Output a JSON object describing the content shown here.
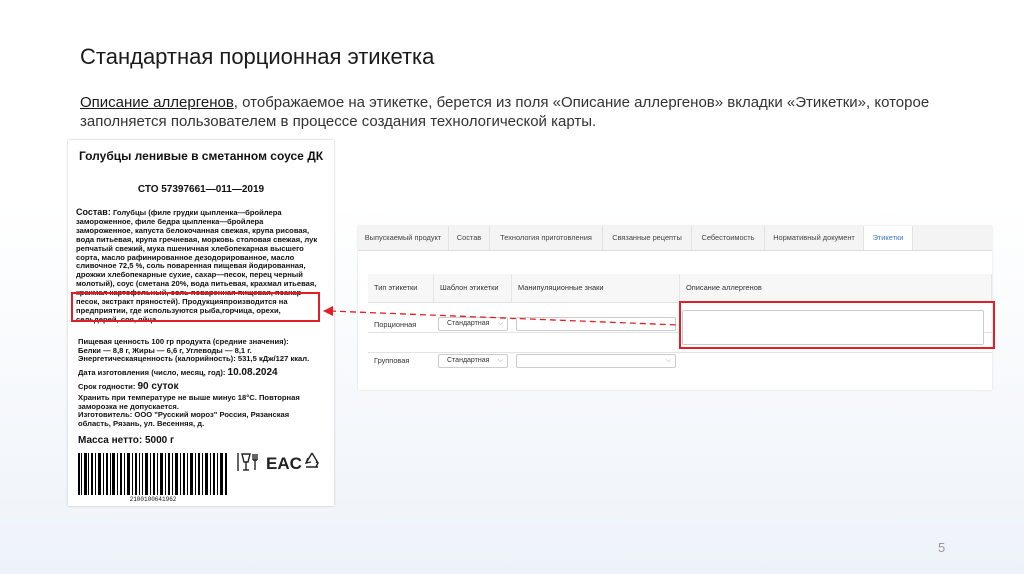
{
  "slide": {
    "title": "Стандартная порционная этикетка",
    "intro_highlight": "Описание аллергенов",
    "intro_rest": ", отображаемое на этикетке, берется из поля «Описание аллергенов» вкладки «Этикетки», которое заполняется пользователем в процессе создания технологической карты.",
    "page_number": "5"
  },
  "label": {
    "product_name": "Голубцы ленивые в сметанном соусе ДК",
    "standard": "СТО 57397661—011—2019",
    "composition_title": "Состав:",
    "composition_text": "Голубцы (филе грудки цыпленка—бройлера замороженное, филе бедра цыпленка—бройлера замороженное, капуста белокочанная свежая, крупа рисовая, вода питьевая, крупа гречневая, морковь столовая свежая, лук репчатый свежий, мука пшеничная хлебопекарная высшего сорта, масло рафинированное дезодорированное, масло сливочное 72,5 %, соль поваренная пищевая йодированная, дрожжи хлебопекарные сухие, сахар—песок, перец черный молотый), соус (сметана 20%, вода питьевая, крахмал итьевая, крахмал картофельный, соль поваренная пищевая, псахар—песок, экстракт пряностей). Продукцияпроизводится на предприятии, где используются рыба,горчица, орехи, сельдерей, соя, яйца.",
    "nutrition_lines": [
      "Пищевая ценность 100 гр продукта (средние значения):",
      "Белки — 8,8 г, Жиры — 6,6 г, Углеводы — 8,1 г.",
      "Энергетическаяценность (калорийность): 531,5 кДж/127 ккал."
    ],
    "made_label": "Дата изготовления (число, месяц, год):",
    "made_value": "10.08.2024",
    "shelf_label": "Срок годности:",
    "shelf_value": "90 суток",
    "storage_text": "Хранить при температуре не выше минус 18°С. Повторная заморозка не допускается.",
    "maker_text": "Изготовитель: ООО \"Русский мороз\" Россия, Рязанская область, Рязань, ул. Весенняя, д.",
    "net_weight": "Масса нетто: 5000 г",
    "barcode_number": "2100100641962",
    "icons": [
      "glass-fork-icon",
      "eac-mark-icon",
      "recycle-icon"
    ]
  },
  "app": {
    "tabs": [
      "Выпускаемый продукт",
      "Состав",
      "Технология приготовления",
      "Связанные рецепты",
      "Себестоимость",
      "Нормативный документ",
      "Этикетки"
    ],
    "active_tab": "Этикетки",
    "columns": [
      "Тип этикетки",
      "Шаблон этикетки",
      "Манипуляционные знаки",
      "Описание аллергенов"
    ],
    "rows": [
      {
        "type": "Порционная",
        "template": "Стандартная",
        "signs": "",
        "allergens": ""
      },
      {
        "type": "Групповая",
        "template": "Стандартная",
        "signs": "",
        "allergens": ""
      }
    ]
  },
  "colors": {
    "highlight": "#e01f26",
    "active_tab_text": "#3a78c2"
  }
}
